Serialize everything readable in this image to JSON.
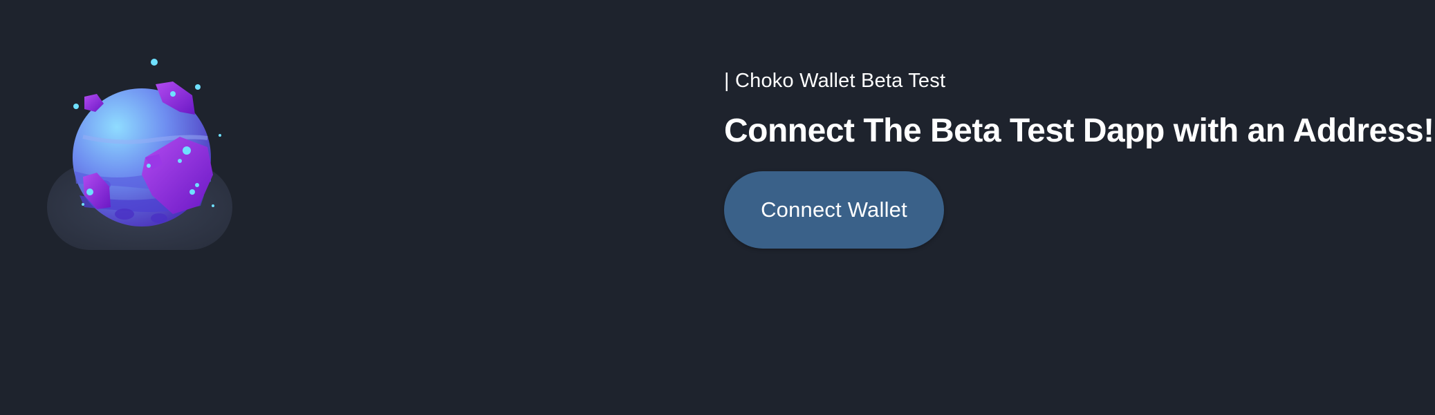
{
  "hero": {
    "image_icon": "purple-planet-illustration"
  },
  "content": {
    "eyebrow": "| Choko Wallet Beta Test",
    "headline": "Connect The Beta Test Dapp with an Address!",
    "connect_button_label": "Connect Wallet"
  },
  "colors": {
    "background": "#1e232d",
    "button": "#3a6189",
    "text": "#ffffff",
    "planet_blue": "#7ec8ff",
    "planet_purple": "#8b2fd9",
    "sparkle_cyan": "#6fe0ff"
  }
}
